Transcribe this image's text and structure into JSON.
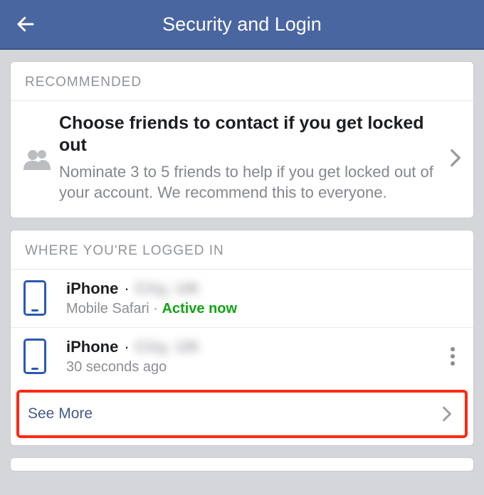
{
  "header": {
    "title": "Security and Login"
  },
  "recommended": {
    "section_label": "RECOMMENDED",
    "title": "Choose friends to contact if you get locked out",
    "subtitle": "Nominate 3 to 5 friends to help if you get locked out of your account. We recommend this to everyone."
  },
  "logged_in": {
    "section_label": "WHERE YOU'RE LOGGED IN",
    "sessions": [
      {
        "device": "iPhone",
        "location": "City, UK",
        "client": "Mobile Safari",
        "status": "Active now",
        "active": true
      },
      {
        "device": "iPhone",
        "location": "City, UK",
        "client": "",
        "status": "30 seconds ago",
        "active": false
      }
    ],
    "see_more": "See More"
  }
}
